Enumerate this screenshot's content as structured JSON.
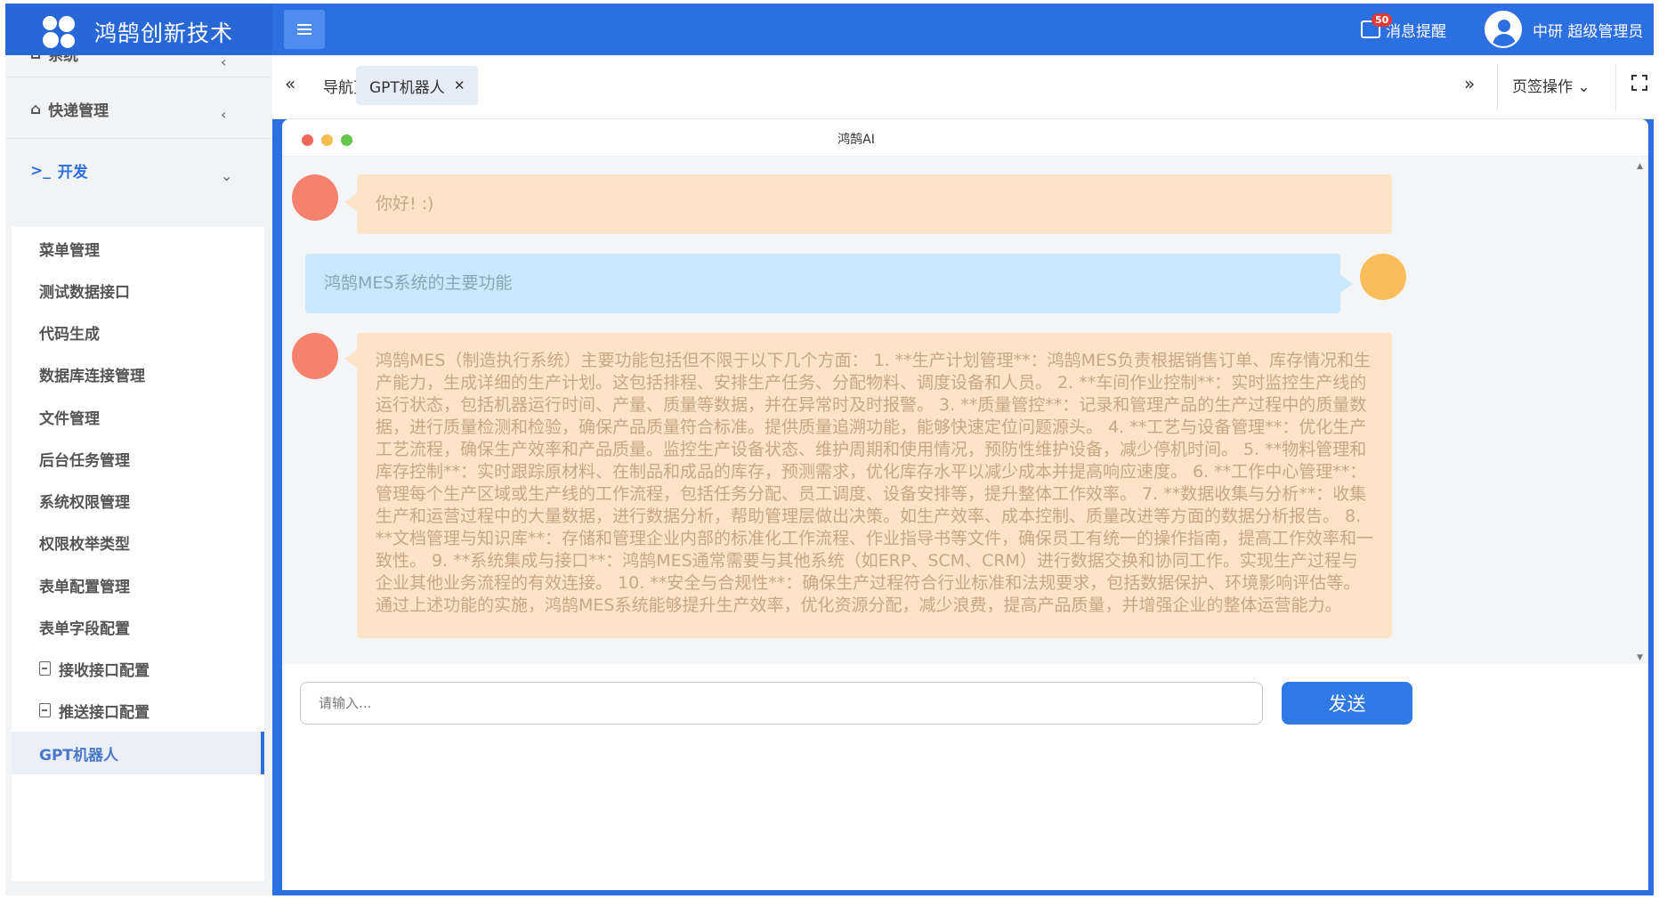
{
  "header": {
    "brand_title": "鸿鹄创新技术",
    "notify_count": "50",
    "notify_label": "消息提醒",
    "user_name": "中研 超级管理员",
    "colors": {
      "primary": "#2b6fe0",
      "brand_bg": "#2767d6"
    }
  },
  "sidebar": {
    "groups": [
      {
        "label": "系统",
        "icon": "home-icon"
      },
      {
        "label": "快递管理",
        "icon": "home-icon"
      },
      {
        "label": "开发",
        "icon": "terminal-icon"
      }
    ],
    "items": [
      {
        "label": "菜单管理"
      },
      {
        "label": "测试数据接口"
      },
      {
        "label": "代码生成"
      },
      {
        "label": "数据库连接管理"
      },
      {
        "label": "文件管理"
      },
      {
        "label": "后台任务管理"
      },
      {
        "label": "系统权限管理"
      },
      {
        "label": "权限枚举类型"
      },
      {
        "label": "表单配置管理"
      },
      {
        "label": "表单字段配置"
      },
      {
        "label": "接收接口配置",
        "icon": "document-icon"
      },
      {
        "label": "推送接口配置",
        "icon": "document-icon"
      },
      {
        "label": "GPT机器人",
        "active": true
      }
    ]
  },
  "tabs": {
    "items": [
      {
        "label": "导航页"
      },
      {
        "label": "GPT机器人",
        "active": true
      }
    ],
    "ops_label": "页签操作"
  },
  "chat": {
    "title": "鸿鹄AI",
    "messages": [
      {
        "role": "bot",
        "text": "你好! :)"
      },
      {
        "role": "user",
        "text": "鸿鹄MES系统的主要功能"
      },
      {
        "role": "bot",
        "text": "鸿鹄MES（制造执行系统）主要功能包括但不限于以下几个方面： 1. **生产计划管理**：鸿鹄MES负责根据销售订单、库存情况和生产能力，生成详细的生产计划。这包括排程、安排生产任务、分配物料、调度设备和人员。 2. **车间作业控制**：实时监控生产线的运行状态，包括机器运行时间、产量、质量等数据，并在异常时及时报警。 3. **质量管控**：记录和管理产品的生产过程中的质量数据，进行质量检测和检验，确保产品质量符合标准。提供质量追溯功能，能够快速定位问题源头。 4. **工艺与设备管理**：优化生产工艺流程，确保生产效率和产品质量。监控生产设备状态、维护周期和使用情况，预防性维护设备，减少停机时间。 5. **物料管理和库存控制**：实时跟踪原材料、在制品和成品的库存，预测需求，优化库存水平以减少成本并提高响应速度。 6. **工作中心管理**：管理每个生产区域或生产线的工作流程，包括任务分配、员工调度、设备安排等，提升整体工作效率。 7. **数据收集与分析**：收集生产和运营过程中的大量数据，进行数据分析，帮助管理层做出决策。如生产效率、成本控制、质量改进等方面的数据分析报告。 8. **文档管理与知识库**：存储和管理企业内部的标准化工作流程、作业指导书等文件，确保员工有统一的操作指南，提高工作效率和一致性。 9. **系统集成与接口**：鸿鹄MES通常需要与其他系统（如ERP、SCM、CRM）进行数据交换和协同工作。实现生产过程与企业其他业务流程的有效连接。 10. **安全与合规性**：确保生产过程符合行业标准和法规要求，包括数据保护、环境影响评估等。 通过上述功能的实施，鸿鹄MES系统能够提升生产效率，优化资源分配，减少浪费，提高产品质量，并增强企业的整体运营能力。"
      }
    ],
    "colors": {
      "bot_avatar": "#f4826c",
      "user_avatar": "#fbbd5c",
      "bot_bubble": "#fde3c8",
      "user_bubble": "#c9e8fb"
    }
  },
  "composer": {
    "placeholder": "请输入...",
    "send_label": "发送"
  }
}
